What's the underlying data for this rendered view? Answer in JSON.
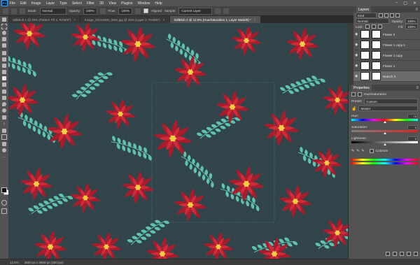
{
  "app": {
    "logo": "Ps",
    "menu": [
      "File",
      "Edit",
      "Image",
      "Layer",
      "Type",
      "Select",
      "Filter",
      "3D",
      "View",
      "Plugins",
      "Window",
      "Help"
    ],
    "window_controls": [
      "–",
      "▢",
      "✕"
    ]
  },
  "options_bar": {
    "mode_label": "Mode:",
    "mode_value": "Normal",
    "opacity_label": "Opacity:",
    "opacity_value": "100%",
    "flow_label": "Flow:",
    "flow_value": "100%",
    "aligned_label": "Aligned",
    "sample_label": "Sample:",
    "sample_value": "Current Layer"
  },
  "tabs": [
    {
      "label": "StillBlob 1 @ 25% (Pattern Fill 1, RGB/8*)",
      "active": false
    },
    {
      "label": "Image_20210930_0001.jpg @ 25% (Layer 2, RGB/8*)",
      "active": false
    },
    {
      "label": "StillBlob 2 @ 12.5% (Hue/Saturation 1, Layer Mask/8) *",
      "active": true
    }
  ],
  "status": {
    "zoom": "12.5%",
    "doc_info": "3600 px x 3600 px (300 ppi)"
  },
  "layers": {
    "tab": "Layers",
    "kind_label": "Kind",
    "blend_mode": "Normal",
    "opacity_label": "Opacity:",
    "opacity_value": "100%",
    "lock_label": "Lock:",
    "fill_label": "Fill:",
    "fill_value": "100%",
    "items": [
      {
        "name": "Flower 2",
        "selected": false
      },
      {
        "name": "Flower 1 copy 2",
        "selected": false
      },
      {
        "name": "Flower 1 copy",
        "selected": false
      },
      {
        "name": "Flower 1",
        "selected": false
      },
      {
        "name": "Branch 3",
        "selected": true
      }
    ]
  },
  "properties": {
    "tab": "Properties",
    "adjustment_title": "Hue/Saturation",
    "preset_label": "Preset:",
    "preset_value": "Custom",
    "channel_value": "Master",
    "hue_label": "Hue:",
    "hue_value": "+5",
    "hue_fraction": 0.51,
    "saturation_label": "Saturation:",
    "saturation_value": "0",
    "saturation_fraction": 0.5,
    "lightness_label": "Lightness:",
    "lightness_value": "0",
    "lightness_fraction": 0.5,
    "colorize_label": "Colorize"
  },
  "colors": {
    "canvas_bg": "#31454a",
    "petal": "#d32a3a",
    "petal_dark": "#a81c2c",
    "leaf": "#5fc3ad",
    "flower_center": "#f2d542"
  }
}
